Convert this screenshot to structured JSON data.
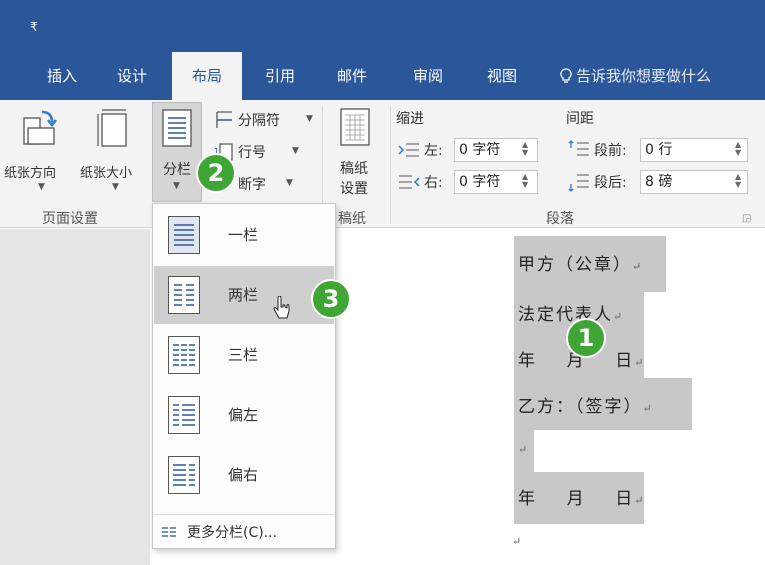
{
  "qat": {
    "icon": "customize-arrow-icon",
    "glyph": "₹"
  },
  "tabs": [
    {
      "label": "插入"
    },
    {
      "label": "设计"
    },
    {
      "label": "布局"
    },
    {
      "label": "引用"
    },
    {
      "label": "邮件"
    },
    {
      "label": "审阅"
    },
    {
      "label": "视图"
    }
  ],
  "active_tab": "布局",
  "tell_me": "告诉我你想要做什么",
  "ribbon": {
    "page_setup": {
      "orientation": "纸张方向",
      "size": "纸张大小",
      "columns": "分栏",
      "breaks": "分隔符",
      "line_numbers": "行号",
      "hyphenation": "断字",
      "group_label": "页面设置"
    },
    "manuscript": {
      "button": "稿纸",
      "button2": "设置",
      "group_label": "稿纸"
    },
    "paragraph": {
      "indent_header": "缩进",
      "spacing_header": "间距",
      "left_label": "左:",
      "left_value": "0 字符",
      "right_label": "右:",
      "right_value": "0 字符",
      "before_label": "段前:",
      "before_value": "0 行",
      "after_label": "段后:",
      "after_value": "8 磅",
      "group_label": "段落"
    }
  },
  "columns_menu": {
    "items": [
      {
        "label": "一栏"
      },
      {
        "label": "两栏"
      },
      {
        "label": "三栏"
      },
      {
        "label": "偏左"
      },
      {
        "label": "偏右"
      }
    ],
    "selected": "一栏",
    "hovered": "两栏",
    "more": "更多分栏(C)..."
  },
  "document": {
    "lines": [
      "甲方（公章）",
      "法定代表人",
      "年    月    日",
      "乙方：（签字）",
      "",
      "年    月    日"
    ],
    "para_mark": "↵"
  },
  "steps": [
    "1",
    "2",
    "3"
  ],
  "colors": {
    "ribbon_blue": "#2b579a",
    "step_green": "#3fa535",
    "selection": "#c8c8c8"
  }
}
